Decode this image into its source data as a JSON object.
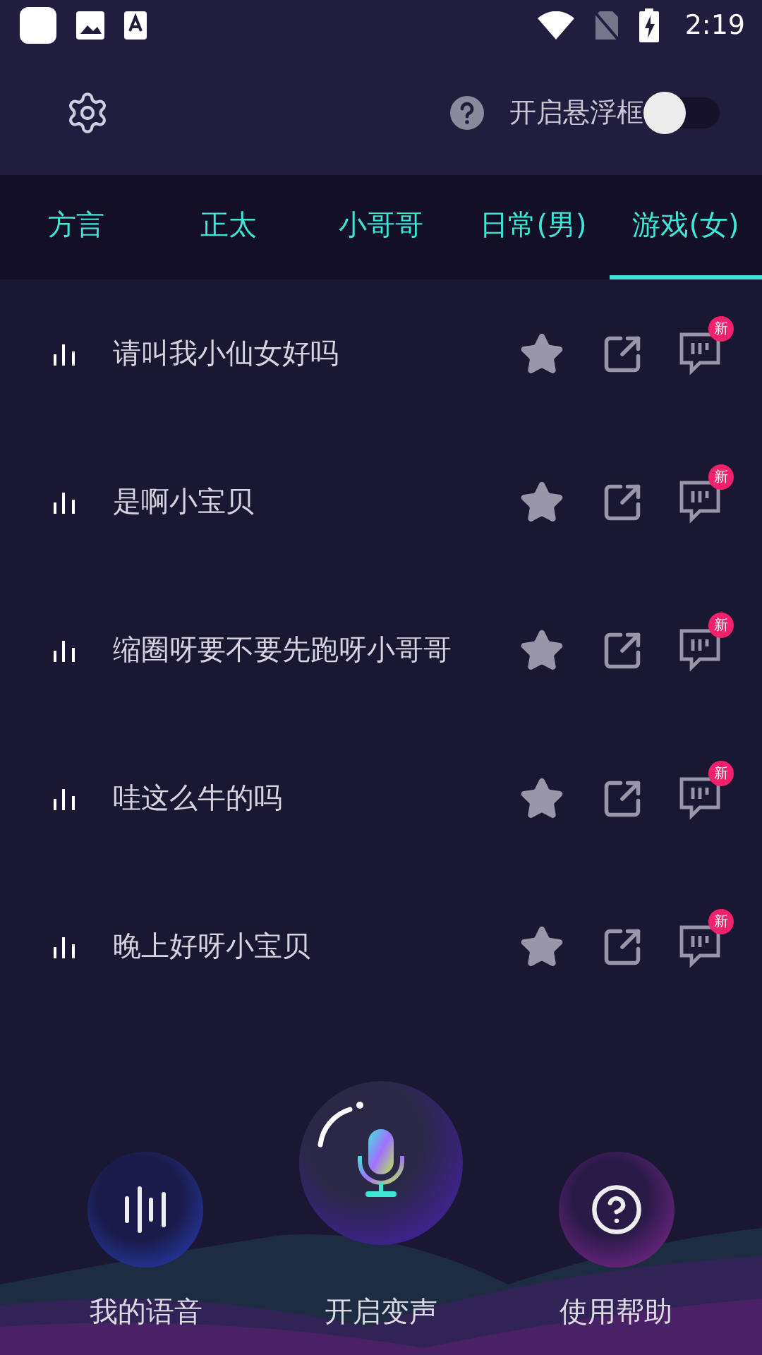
{
  "status_bar": {
    "time": "2:19"
  },
  "header": {
    "floating_label": "开启悬浮框",
    "floating_on": false
  },
  "tabs": [
    {
      "label": "方言",
      "selected": false
    },
    {
      "label": "正太",
      "selected": false
    },
    {
      "label": "小哥哥",
      "selected": false
    },
    {
      "label": "日常(男)",
      "selected": false
    },
    {
      "label": "游戏(女)",
      "selected": true
    }
  ],
  "voices": [
    {
      "title": "请叫我小仙女好吗",
      "badge": "新"
    },
    {
      "title": "是啊小宝贝",
      "badge": "新"
    },
    {
      "title": "缩圈呀要不要先跑呀小哥哥",
      "badge": "新"
    },
    {
      "title": "哇这么牛的吗",
      "badge": "新"
    },
    {
      "title": "晚上好呀小宝贝",
      "badge": "新"
    }
  ],
  "bottom_actions": [
    {
      "kind": "voice",
      "label": "我的语音"
    },
    {
      "kind": "mic",
      "label": "开启变声"
    },
    {
      "kind": "help",
      "label": "使用帮助"
    }
  ]
}
